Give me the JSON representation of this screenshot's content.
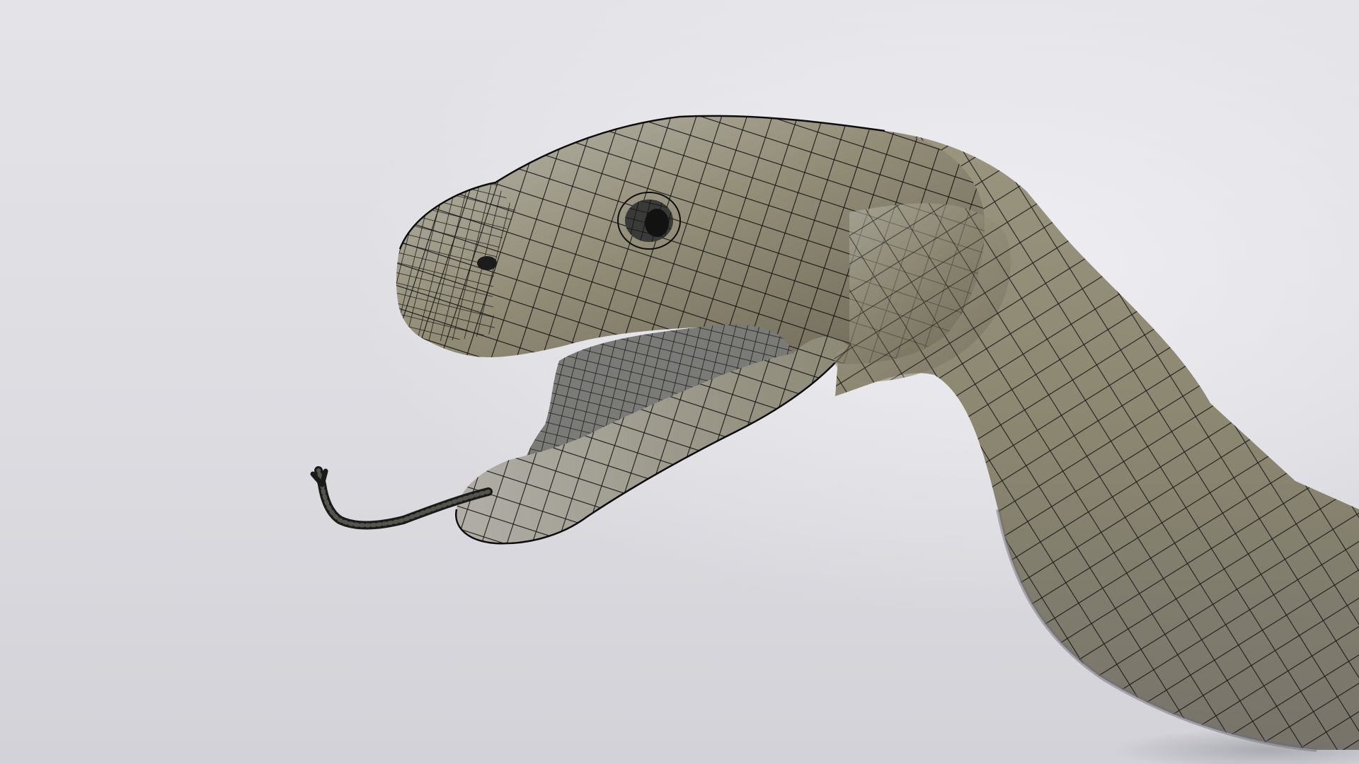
{
  "scene": {
    "subject": "snake-head-wireframe-render",
    "colors": {
      "backdrop_light": "#e6e6ea",
      "backdrop_dark": "#d0d0d6",
      "skin_light": "#b5b2a6",
      "skin_mid": "#8f8a74",
      "skin_dark": "#5c5848",
      "mouth_inner": "#777772",
      "wire": "#0d0d0d",
      "eye": "#121212"
    }
  }
}
